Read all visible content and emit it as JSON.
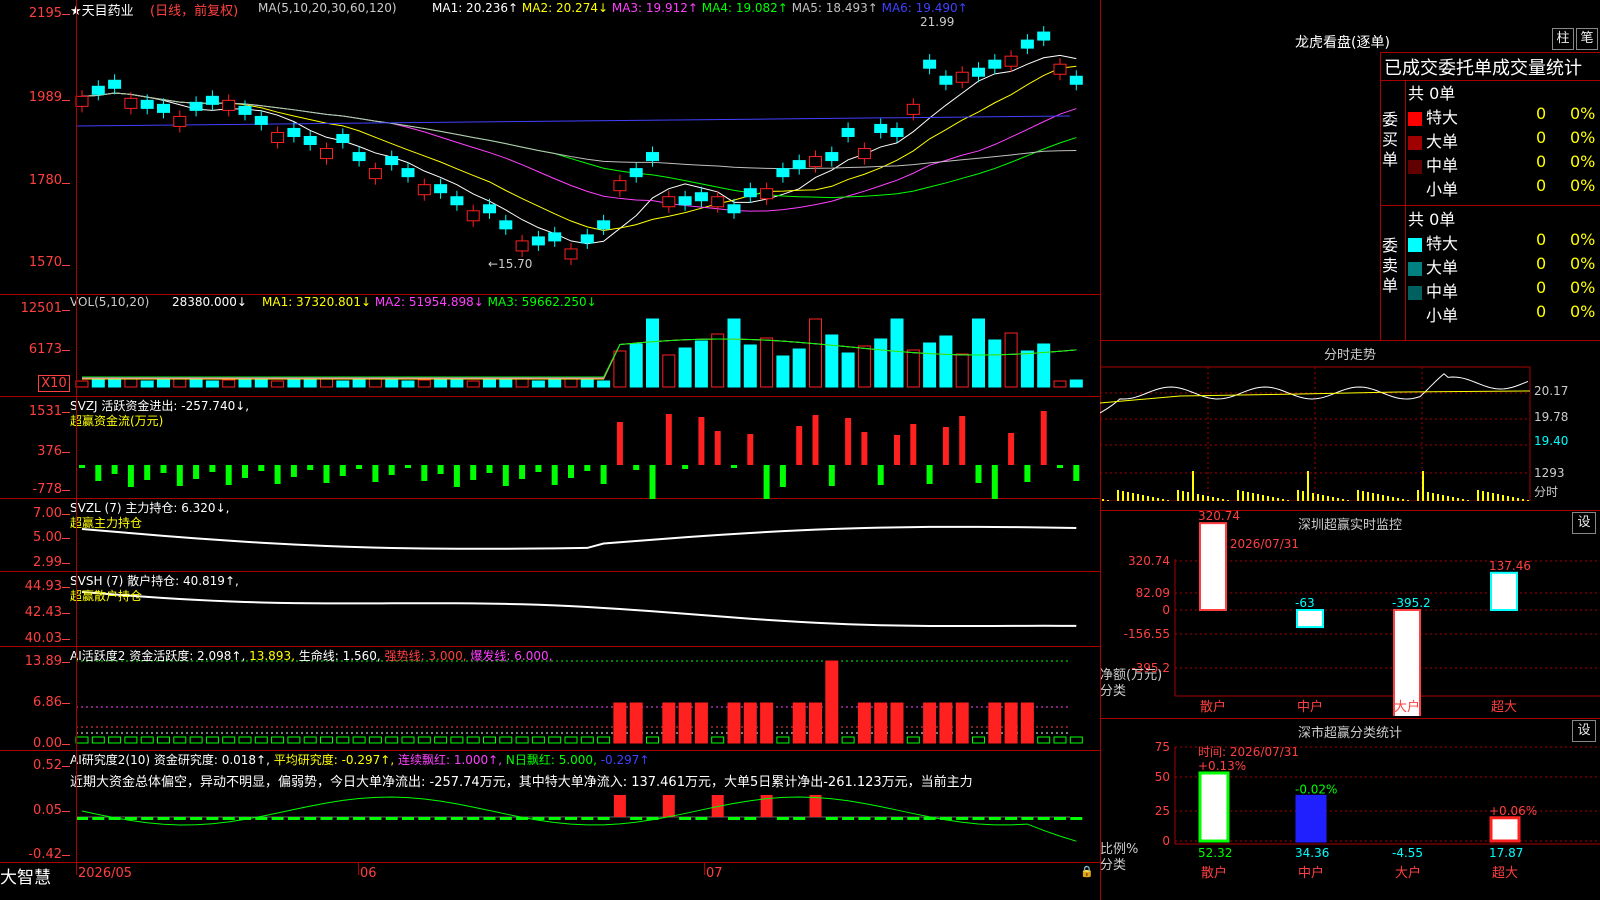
{
  "app": {
    "brand": "大智慧",
    "stock_name": "★天目药业",
    "period_note": "(日线，前复权)"
  },
  "ma_line": {
    "label": "MA(5,10,20,30,60,120)",
    "items": [
      {
        "text": "MA1: 20.236↑",
        "color": "#ffffff"
      },
      {
        "text": "MA2: 20.274↓",
        "color": "#ffff00"
      },
      {
        "text": "MA3: 19.912↑",
        "color": "#ff40ff"
      },
      {
        "text": "MA4: 19.082↑",
        "color": "#00ff00"
      },
      {
        "text": "MA5: 18.493↑",
        "color": "#c0c0c0"
      },
      {
        "text": "MA6: 19.490↑",
        "color": "#4040ff"
      }
    ],
    "hi_label": "21.99",
    "lo_label": "←15.70"
  },
  "price_axis": [
    "2195",
    "1989",
    "1780",
    "1570"
  ],
  "vol": {
    "label": "VOL(5,10,20)",
    "value": "28380.000↓",
    "items": [
      {
        "text": "MA1: 37320.801↓",
        "color": "#ffff00"
      },
      {
        "text": "MA2: 51954.898↓",
        "color": "#ff40ff"
      },
      {
        "text": "MA3: 59662.250↓",
        "color": "#00ff00"
      }
    ],
    "axis": [
      "12501",
      "6173"
    ],
    "unit": "X10"
  },
  "svzj": {
    "label": "SVZJ  活跃资金进出: -257.740↓,",
    "sub": "超赢资金流(万元)",
    "axis": [
      "1531",
      "376",
      "-778"
    ]
  },
  "svzl": {
    "label": "SVZL (7) 主力持仓: 6.320↓,",
    "sub": "超赢主力持仓",
    "axis": [
      "7.00",
      "5.00",
      "2.99"
    ]
  },
  "svsh": {
    "label": "SVSH (7) 散户持仓: 40.819↑,",
    "sub": "超赢散户持仓",
    "axis": [
      "44.93",
      "42.43",
      "40.03"
    ]
  },
  "aihy": {
    "items": [
      {
        "text": "AI活跃度2 资金活跃度: 2.098↑,",
        "color": "#ffffff"
      },
      {
        "text": "13.893,",
        "color": "#ffff00"
      },
      {
        "text": "生命线: 1.560,",
        "color": "#ffffff"
      },
      {
        "text": "强势线: 3.000,",
        "color": "#ff4040"
      },
      {
        "text": "爆发线: 6.000,",
        "color": "#ff40ff"
      }
    ],
    "axis": [
      "13.89",
      "6.86",
      "0.00"
    ]
  },
  "aiyj": {
    "items": [
      {
        "text": "AI研究度2(10) 资金研究度: 0.018↑,",
        "color": "#ffffff"
      },
      {
        "text": "平均研究度: -0.297↑,",
        "color": "#ffff00"
      },
      {
        "text": "连续飘红: 1.000↑,",
        "color": "#ff40ff"
      },
      {
        "text": "N日飘红: 5.000,",
        "color": "#00ff00"
      },
      {
        "text": "-0.297↑",
        "color": "#4040ff"
      }
    ],
    "comment": "近期大资金总体偏空，异动不明显，偏弱势，今日大单净流出: -257.74万元，其中特大单净流入: 137.461万元，大单5日累计净出-261.123万元，当前主力",
    "axis": [
      "0.52",
      "0.05",
      "-0.42"
    ]
  },
  "date_axis": [
    "2026/05",
    "06",
    "07"
  ],
  "lhb": {
    "title": "龙虎看盘(逐单)",
    "btn1": "柱",
    "btn2": "笔",
    "subtitle": "已成交委托单成交量统计",
    "buy": {
      "side": "委买单",
      "total": "共 0单",
      "rows": [
        {
          "label": "特大",
          "color": "#ff0000",
          "v": "0",
          "p": "0%"
        },
        {
          "label": "大单",
          "color": "#a00000",
          "v": "0",
          "p": "0%"
        },
        {
          "label": "中单",
          "color": "#600000",
          "v": "0",
          "p": "0%"
        },
        {
          "label": "小单",
          "color": "#000000",
          "v": "0",
          "p": "0%"
        }
      ]
    },
    "sell": {
      "side": "委卖单",
      "total": "共 0单",
      "rows": [
        {
          "label": "特大",
          "color": "#00ffff",
          "v": "0",
          "p": "0%"
        },
        {
          "label": "大单",
          "color": "#008080",
          "v": "0",
          "p": "0%"
        },
        {
          "label": "中单",
          "color": "#006060",
          "v": "0",
          "p": "0%"
        },
        {
          "label": "小单",
          "color": "#000000",
          "v": "0",
          "p": "0%"
        }
      ]
    }
  },
  "fenshi": {
    "title": "分时走势",
    "axis": [
      "20.17",
      "19.78",
      "19.40",
      "1293",
      "分时"
    ]
  },
  "sz_monitor": {
    "title": "深圳超赢实时监控",
    "btn": "设",
    "time": "时间: 2026/07/31",
    "axis": [
      "320.74",
      "82.09",
      "0",
      "-156.55",
      "-395.2"
    ],
    "ylabel": "净额(万元)",
    "xlabel": "分类",
    "bars": [
      {
        "cat": "散户",
        "val": 320.74,
        "label": "320.74",
        "color": "#ffffff"
      },
      {
        "cat": "中户",
        "val": -63,
        "label": "-63",
        "color": "#ffffff"
      },
      {
        "cat": "大户",
        "val": -395.2,
        "label": "-395.2",
        "color": "#ffffff"
      },
      {
        "cat": "超大",
        "val": 137.46,
        "label": "137.46",
        "color": "#ffffff"
      }
    ]
  },
  "sz_class": {
    "title": "深市超赢分类统计",
    "btn": "设",
    "time": "时间: 2026/07/31",
    "axis": [
      "75",
      "50",
      "25",
      "0"
    ],
    "ylabel": "比例%",
    "xlabel": "分类",
    "bars": [
      {
        "cat": "散户",
        "val": 52.32,
        "top": "+0.13%",
        "bottom": "52.32"
      },
      {
        "cat": "中户",
        "val": 34.36,
        "top": "-0.02%",
        "bottom": "34.36"
      },
      {
        "cat": "大户",
        "val": -4.55,
        "top": "",
        "bottom": "-4.55"
      },
      {
        "cat": "超大",
        "val": 17.87,
        "top": "+0.06%",
        "bottom": "17.87"
      }
    ]
  }
}
